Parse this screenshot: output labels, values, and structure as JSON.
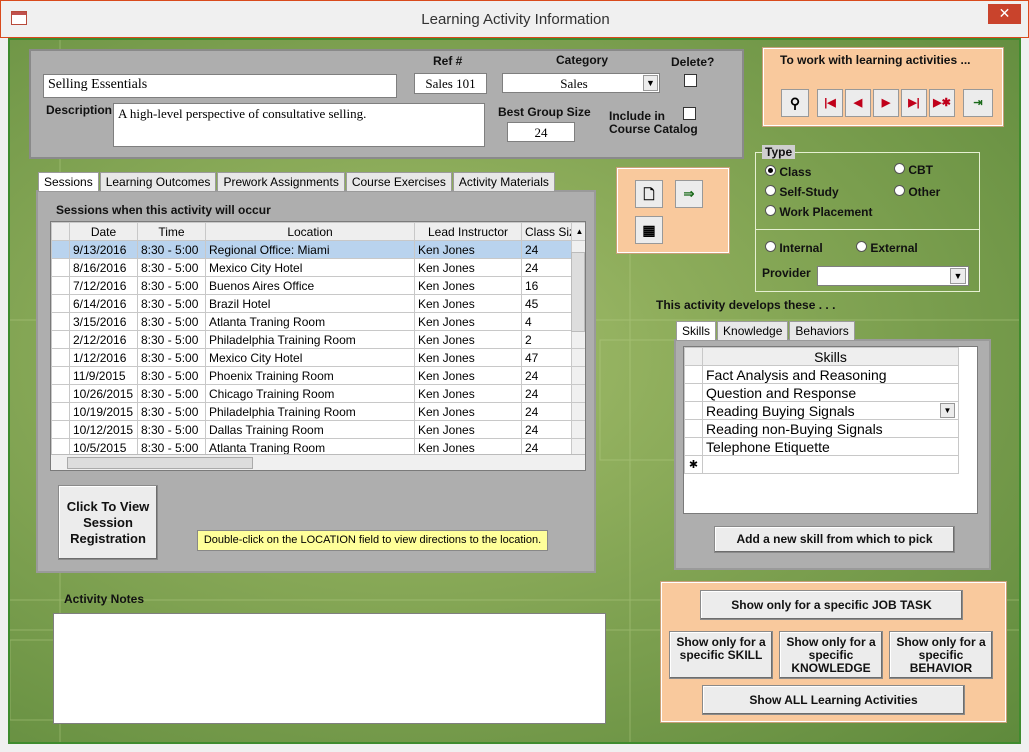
{
  "window": {
    "title": "Learning Activity Information",
    "close_label": "✕"
  },
  "header": {
    "activity_name": "Selling Essentials",
    "ref_label": "Ref #",
    "ref_value": "Sales 101",
    "category_label": "Category",
    "category_value": "Sales",
    "delete_label": "Delete?",
    "description_label": "Description",
    "description_value": "A high-level perspective of consultative selling.",
    "best_group_label": "Best Group Size",
    "best_group_value": "24",
    "catalog_label_1": "Include in",
    "catalog_label_2": "Course Catalog"
  },
  "nav": {
    "title": "To work with learning activities ..."
  },
  "type": {
    "title": "Type",
    "options": [
      {
        "label": "Class",
        "on": true
      },
      {
        "label": "Self-Study",
        "on": false
      },
      {
        "label": "Work Placement",
        "on": false
      },
      {
        "label": "CBT",
        "on": false
      },
      {
        "label": "Other",
        "on": false
      }
    ],
    "internal_label": "Internal",
    "external_label": "External",
    "provider_label": "Provider",
    "provider_value": ""
  },
  "tabs": [
    "Sessions",
    "Learning Outcomes",
    "Prework Assignments",
    "Course Exercises",
    "Activity Materials"
  ],
  "sessions": {
    "heading": "Sessions when this activity will occur",
    "columns": [
      "Date",
      "Time",
      "Location",
      "Lead Instructor",
      "Class Siz"
    ],
    "rows": [
      [
        "9/13/2016",
        "8:30 - 5:00",
        "Regional Office: Miami",
        "Ken Jones",
        "24"
      ],
      [
        "8/16/2016",
        "8:30 - 5:00",
        "Mexico City Hotel",
        "Ken Jones",
        "24"
      ],
      [
        "7/12/2016",
        "8:30 - 5:00",
        "Buenos Aires Office",
        "Ken Jones",
        "16"
      ],
      [
        "6/14/2016",
        "8:30 - 5:00",
        "Brazil Hotel",
        "Ken Jones",
        "45"
      ],
      [
        "3/15/2016",
        "8:30 - 5:00",
        "Atlanta Traning Room",
        "Ken Jones",
        "4"
      ],
      [
        "2/12/2016",
        "8:30 - 5:00",
        "Philadelphia Training Room",
        "Ken Jones",
        "2"
      ],
      [
        "1/12/2016",
        "8:30 - 5:00",
        "Mexico City Hotel",
        "Ken Jones",
        "47"
      ],
      [
        "11/9/2015",
        "8:30 - 5:00",
        "Phoenix Training Room",
        "Ken Jones",
        "24"
      ],
      [
        "10/26/2015",
        "8:30 - 5:00",
        "Chicago Training Room",
        "Ken Jones",
        "24"
      ],
      [
        "10/19/2015",
        "8:30 - 5:00",
        "Philadelphia Training Room",
        "Ken Jones",
        "24"
      ],
      [
        "10/12/2015",
        "8:30 - 5:00",
        "Dallas Training Room",
        "Ken Jones",
        "24"
      ],
      [
        "10/5/2015",
        "8:30 - 5:00",
        "Atlanta Traning Room",
        "Ken Jones",
        "24"
      ]
    ],
    "view_btn": "Click To View Session Registration",
    "hint": "Double-click on the LOCATION field to view directions to the location."
  },
  "develops": {
    "heading": "This activity develops these . . .",
    "tabs": [
      "Skills",
      "Knowledge",
      "Behaviors"
    ],
    "column": "Skills",
    "items": [
      "Fact Analysis and Reasoning",
      "Question and Response",
      "Reading Buying Signals",
      "Reading non-Buying Signals",
      "Telephone Etiquette"
    ],
    "new_row_marker": "✱",
    "add_btn": "Add a new skill from which to pick"
  },
  "notes": {
    "label": "Activity Notes",
    "value": ""
  },
  "filters": {
    "job_task": "Show only for a specific JOB TASK",
    "skill": "Show only for a specific SKILL",
    "knowledge": "Show only for a specific KNOWLEDGE",
    "behavior": "Show only for a specific BEHAVIOR",
    "all": "Show ALL Learning Activities"
  }
}
